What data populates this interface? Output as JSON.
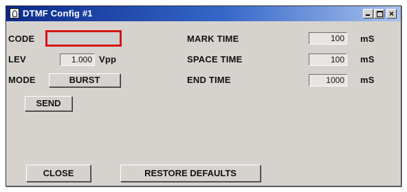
{
  "window": {
    "title": "DTMF Config #1",
    "controls": {
      "minimize": "_",
      "maximize": "□",
      "close": "x"
    }
  },
  "form": {
    "code": {
      "label": "CODE",
      "value": ""
    },
    "level": {
      "label": "LEV",
      "value": "1.000",
      "unit": "Vpp"
    },
    "mode": {
      "label": "MODE",
      "value": "BURST"
    },
    "mark_time": {
      "label": "MARK TIME",
      "value": "100",
      "unit": "mS"
    },
    "space_time": {
      "label": "SPACE TIME",
      "value": "100",
      "unit": "mS"
    },
    "end_time": {
      "label": "END TIME",
      "value": "1000",
      "unit": "mS"
    }
  },
  "buttons": {
    "send": "SEND",
    "close": "CLOSE",
    "restore_defaults": "RESTORE DEFAULTS"
  },
  "colors": {
    "title_bar_start": "#0b2a8c",
    "title_bar_end": "#a9c2ee",
    "focus_outline": "#d41414",
    "panel": "#d6d3cf"
  }
}
